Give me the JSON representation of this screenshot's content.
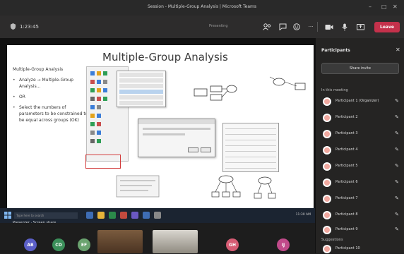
{
  "window": {
    "title": "Session - Multiple-Group Analysis | Microsoft Teams",
    "controls": [
      "–",
      "□",
      "✕"
    ]
  },
  "toolbar": {
    "timer": "1:23:45",
    "share_status": "Presenting",
    "leave_label": "Leave",
    "buttons": [
      {
        "name": "people-icon",
        "glyph": "👥"
      },
      {
        "name": "chat-icon",
        "glyph": "💬"
      },
      {
        "name": "reactions-icon",
        "glyph": "☺"
      },
      {
        "name": "more-icon",
        "glyph": "···"
      },
      {
        "name": "camera-icon",
        "glyph": "■"
      },
      {
        "name": "mic-icon",
        "glyph": "🎤"
      },
      {
        "name": "share-icon",
        "glyph": "⇪"
      }
    ],
    "colors": {
      "leave": "#c4314b"
    }
  },
  "slide": {
    "title": "Multiple-Group Analysis",
    "lead": "Multiple-Group Analysis",
    "bullets": [
      "Analyze → Multiple-Group Analysis...",
      "OR",
      "Select the numbers of parameters to be constrained to be equal across groups (OK)"
    ]
  },
  "taskbar": {
    "search_placeholder": "Type here to search",
    "clock": "11:30 AM"
  },
  "presenter": {
    "label": "Presenter · Screen share"
  },
  "panel": {
    "title": "Participants",
    "share_invite": "Share invite",
    "in_meeting_label": "In this meeting",
    "participants": [
      {
        "name": "Participant 1 (Organizer)",
        "muted": true
      },
      {
        "name": "Participant 2",
        "muted": true
      },
      {
        "name": "Participant 3",
        "muted": true
      },
      {
        "name": "Participant 4",
        "muted": true
      },
      {
        "name": "Participant 5",
        "muted": true
      },
      {
        "name": "Participant 6",
        "muted": true
      },
      {
        "name": "Participant 7",
        "muted": true
      },
      {
        "name": "Participant 8",
        "muted": true
      },
      {
        "name": "Participant 9",
        "muted": true
      }
    ],
    "others_label": "Suggestions",
    "other_name": "Participant 10"
  },
  "video_strip": {
    "avatars": [
      {
        "initials": "AB",
        "color": "#5b5fc7"
      },
      {
        "initials": "CD",
        "color": "#3b8f5a"
      },
      {
        "initials": "EF",
        "color": "#6aa36f"
      },
      {
        "initials": "GH",
        "color": "#d65c74"
      },
      {
        "initials": "IJ",
        "color": "#c04a8a"
      }
    ]
  }
}
